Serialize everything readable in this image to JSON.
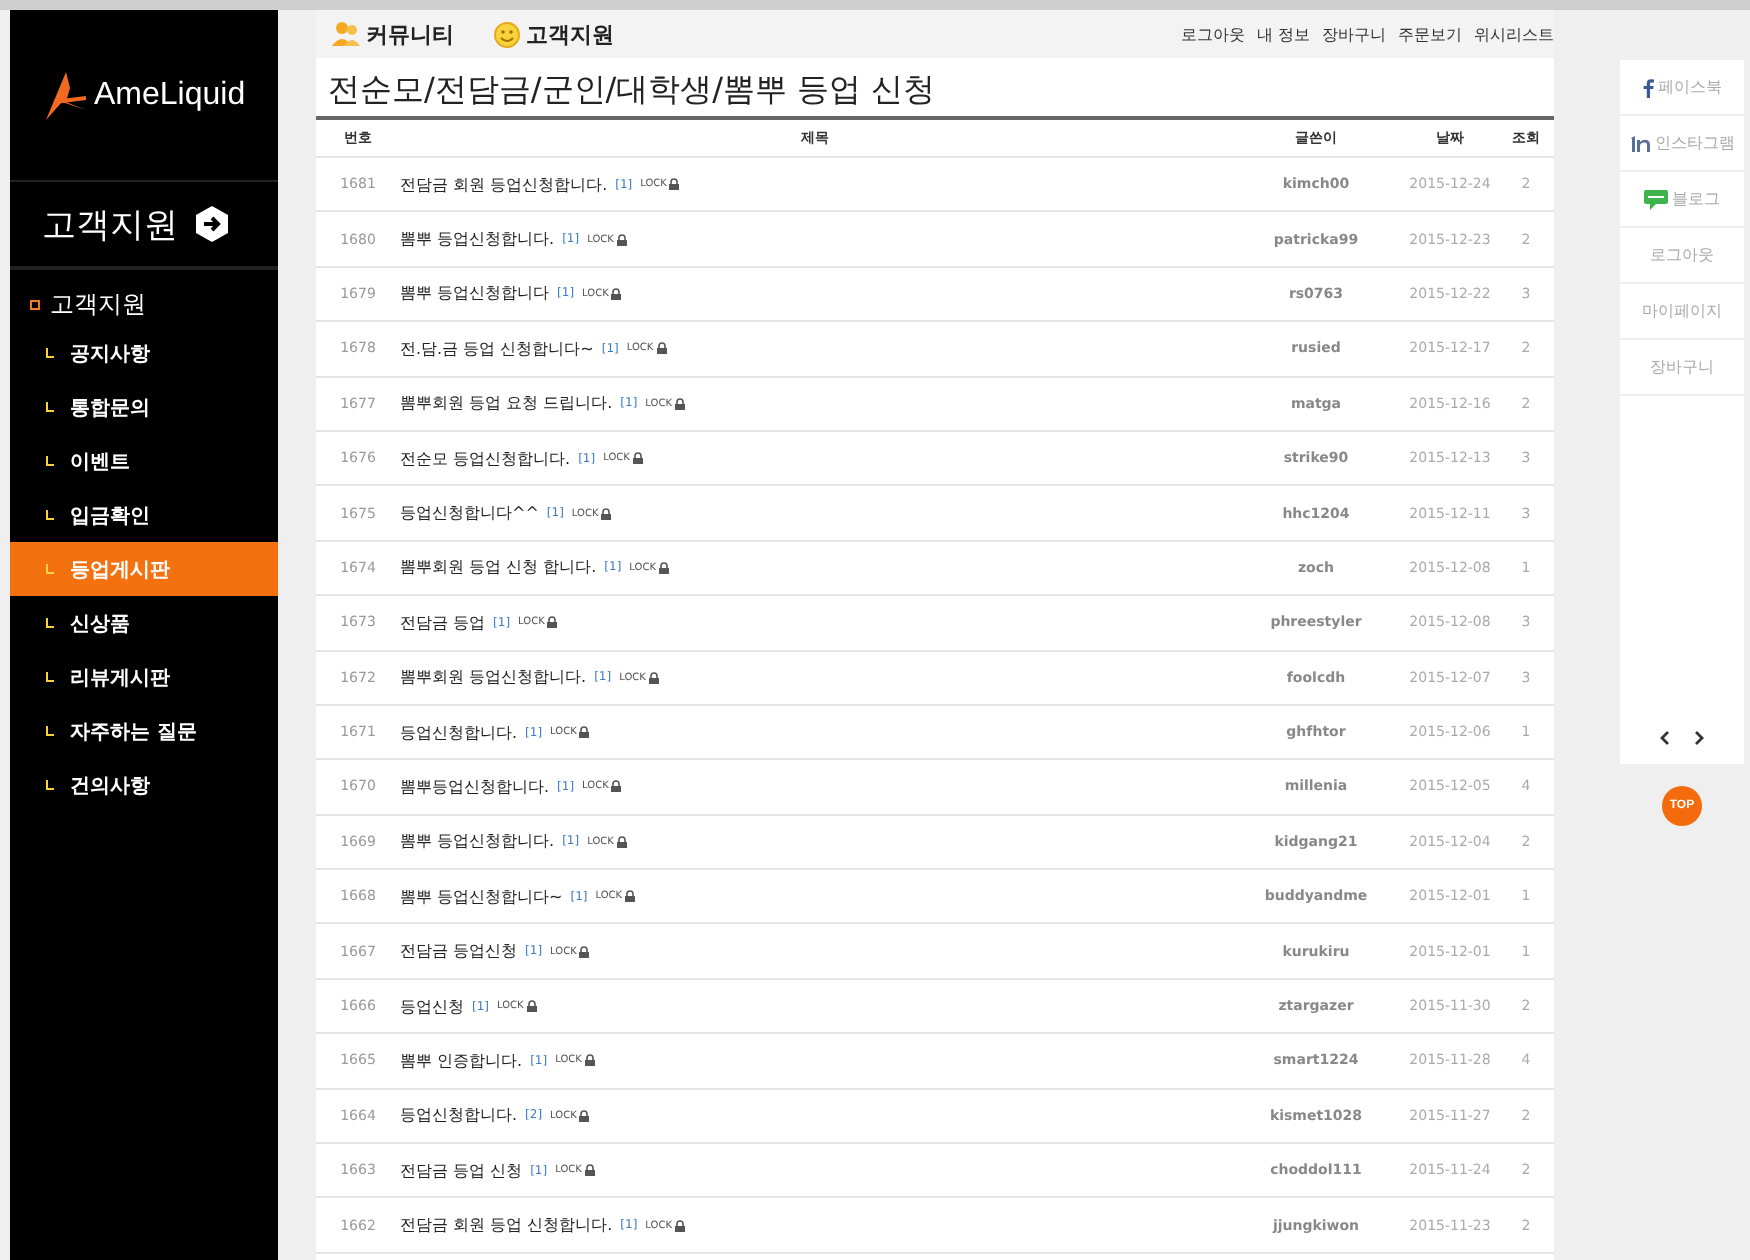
{
  "sidebar": {
    "logo": "AmeLiquid",
    "heading": "고객지원",
    "section": "고객지원",
    "items": [
      {
        "label": "공지사항",
        "selected": false
      },
      {
        "label": "통합문의",
        "selected": false
      },
      {
        "label": "이벤트",
        "selected": false
      },
      {
        "label": "입금확인",
        "selected": false
      },
      {
        "label": "등업게시판",
        "selected": true
      },
      {
        "label": "신상품",
        "selected": false
      },
      {
        "label": "리뷰게시판",
        "selected": false
      },
      {
        "label": "자주하는 질문",
        "selected": false
      },
      {
        "label": "건의사항",
        "selected": false
      }
    ]
  },
  "top_bar": {
    "tabs": [
      {
        "label": "커뮤니티",
        "kind": "person"
      },
      {
        "label": "고객지원",
        "kind": "smile"
      }
    ],
    "links": [
      "로그아웃",
      "내 정보",
      "장바구니",
      "주문보기",
      "위시리스트"
    ]
  },
  "page_title": "전순모/전담금/군인/대학생/뽐뿌 등업 신청",
  "table": {
    "columns": [
      "번호",
      "제목",
      "글쓴이",
      "날짜",
      "조회"
    ],
    "rows": [
      {
        "number": "1681",
        "subject": {
          "text": "전담금 회원 등업신청합니다.",
          "comment_count": "[1]",
          "lock": "LOCK"
        },
        "author": "kimch00",
        "date": "2015-12-24",
        "views": "2"
      },
      {
        "number": "1680",
        "subject": {
          "text": "뽐뿌 등업신청합니다.",
          "comment_count": "[1]",
          "lock": "LOCK"
        },
        "author": "patricka99",
        "date": "2015-12-23",
        "views": "2"
      },
      {
        "number": "1679",
        "subject": {
          "text": "뽐뿌 등업신청합니다",
          "comment_count": "[1]",
          "lock": "LOCK"
        },
        "author": "rs0763",
        "date": "2015-12-22",
        "views": "3"
      },
      {
        "number": "1678",
        "subject": {
          "text": "전.담.금 등업 신청합니다~",
          "comment_count": "[1]",
          "lock": "LOCK"
        },
        "author": "rusied",
        "date": "2015-12-17",
        "views": "2"
      },
      {
        "number": "1677",
        "subject": {
          "text": "뽐뿌회원 등업 요청 드립니다.",
          "comment_count": "[1]",
          "lock": "LOCK"
        },
        "author": "matga",
        "date": "2015-12-16",
        "views": "2"
      },
      {
        "number": "1676",
        "subject": {
          "text": "전순모 등업신청합니다.",
          "comment_count": "[1]",
          "lock": "LOCK"
        },
        "author": "strike90",
        "date": "2015-12-13",
        "views": "3"
      },
      {
        "number": "1675",
        "subject": {
          "text": "등업신청합니다^^",
          "comment_count": "[1]",
          "lock": "LOCK"
        },
        "author": "hhc1204",
        "date": "2015-12-11",
        "views": "3"
      },
      {
        "number": "1674",
        "subject": {
          "text": "뽐뿌회원 등업 신청 합니다.",
          "comment_count": "[1]",
          "lock": "LOCK"
        },
        "author": "zoch",
        "date": "2015-12-08",
        "views": "1"
      },
      {
        "number": "1673",
        "subject": {
          "text": "전담금 등업",
          "comment_count": "[1]",
          "lock": "LOCK"
        },
        "author": "phreestyler",
        "date": "2015-12-08",
        "views": "3"
      },
      {
        "number": "1672",
        "subject": {
          "text": "뽐뿌회원 등업신청합니다.",
          "comment_count": "[1]",
          "lock": "LOCK"
        },
        "author": "foolcdh",
        "date": "2015-12-07",
        "views": "3"
      },
      {
        "number": "1671",
        "subject": {
          "text": "등업신청합니다.",
          "comment_count": "[1]",
          "lock": "LOCK"
        },
        "author": "ghfhtor",
        "date": "2015-12-06",
        "views": "1"
      },
      {
        "number": "1670",
        "subject": {
          "text": "뽐뿌등업신청합니다.",
          "comment_count": "[1]",
          "lock": "LOCK"
        },
        "author": "millenia",
        "date": "2015-12-05",
        "views": "4"
      },
      {
        "number": "1669",
        "subject": {
          "text": "뽐뿌 등업신청합니다.",
          "comment_count": "[1]",
          "lock": "LOCK"
        },
        "author": "kidgang21",
        "date": "2015-12-04",
        "views": "2"
      },
      {
        "number": "1668",
        "subject": {
          "text": "뽐뿌 등업신청합니다~",
          "comment_count": "[1]",
          "lock": "LOCK"
        },
        "author": "buddyandme",
        "date": "2015-12-01",
        "views": "1"
      },
      {
        "number": "1667",
        "subject": {
          "text": "전담금 등업신청",
          "comment_count": "[1]",
          "lock": "LOCK"
        },
        "author": "kurukiru",
        "date": "2015-12-01",
        "views": "1"
      },
      {
        "number": "1666",
        "subject": {
          "text": "등업신청",
          "comment_count": "[1]",
          "lock": "LOCK"
        },
        "author": "ztargazer",
        "date": "2015-11-30",
        "views": "2"
      },
      {
        "number": "1665",
        "subject": {
          "text": "뽐뿌 인증합니다.",
          "comment_count": "[1]",
          "lock": "LOCK"
        },
        "author": "smart1224",
        "date": "2015-11-28",
        "views": "4"
      },
      {
        "number": "1664",
        "subject": {
          "text": "등업신청합니다.",
          "comment_count": "[2]",
          "lock": "LOCK"
        },
        "author": "kismet1028",
        "date": "2015-11-27",
        "views": "2"
      },
      {
        "number": "1663",
        "subject": {
          "text": "전담금 등업 신청",
          "comment_count": "[1]",
          "lock": "LOCK"
        },
        "author": "choddol111",
        "date": "2015-11-24",
        "views": "2"
      },
      {
        "number": "1662",
        "subject": {
          "text": "전담금 회원 등업 신청합니다.",
          "comment_count": "[1]",
          "lock": "LOCK"
        },
        "author": "jjungkiwon",
        "date": "2015-11-23",
        "views": "2"
      }
    ]
  },
  "right_rail": {
    "items": [
      {
        "label": "페이스북",
        "kind": "facebook"
      },
      {
        "label": "인스타그램",
        "kind": "instagram"
      },
      {
        "label": "블로그",
        "kind": "blog"
      },
      {
        "label": "로그아웃",
        "kind": "text"
      },
      {
        "label": "마이페이지",
        "kind": "text"
      },
      {
        "label": "장바구니",
        "kind": "text"
      }
    ],
    "top_button": "TOP"
  }
}
